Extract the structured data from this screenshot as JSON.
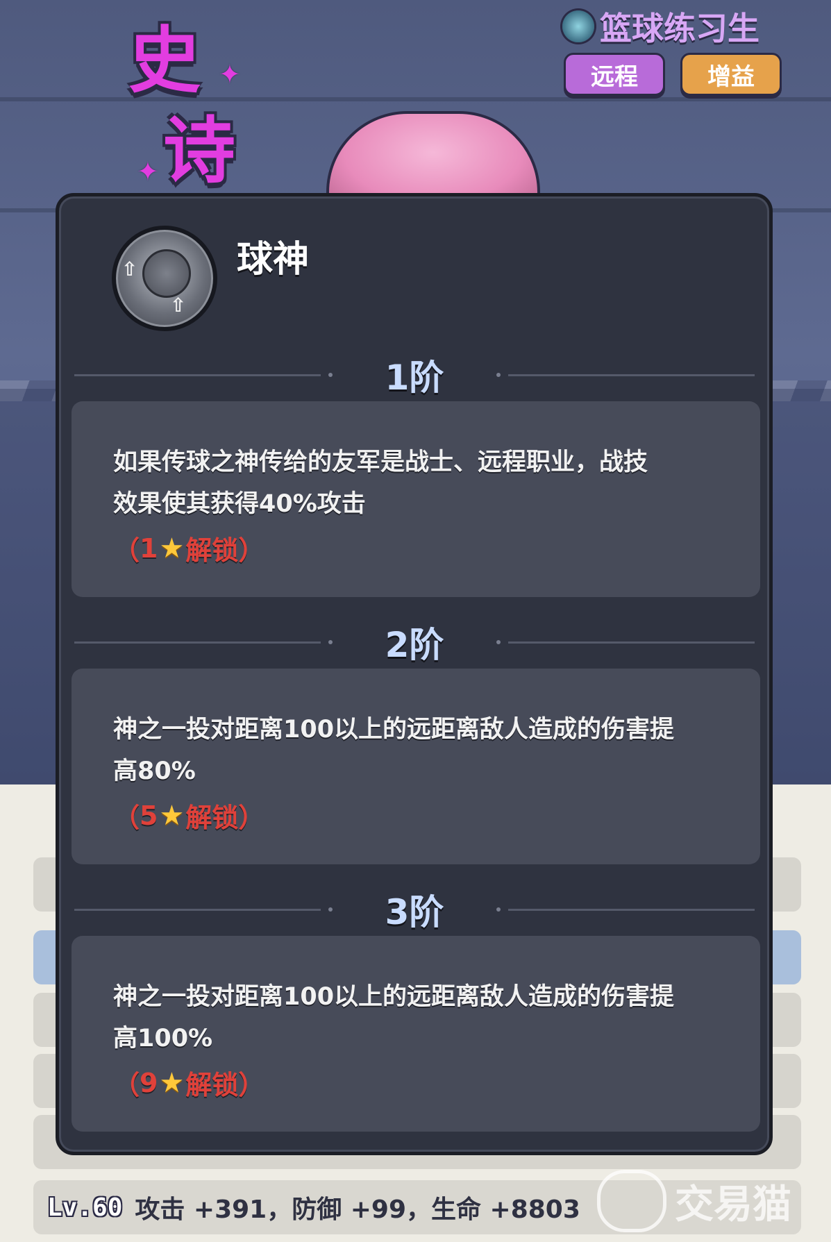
{
  "header": {
    "hero_name": "篮球练习生",
    "class_icon": "class-emblem-icon",
    "tags": [
      "远程",
      "增益"
    ],
    "rarity": [
      "史",
      "诗"
    ]
  },
  "skill": {
    "icon": "basketball-skill-icon",
    "name": "球神"
  },
  "tiers": [
    {
      "label": "1阶",
      "desc_line1": "如果传球之神传给的友军是战士、远程职业，战技",
      "desc_line2": "效果使其获得40%攻击",
      "unlock_open": "（",
      "unlock_stars": "1",
      "unlock_text": "解锁）"
    },
    {
      "label": "2阶",
      "desc_line1": "神之一投对距离100以上的远距离敌人造成的伤害提",
      "desc_line2": "高80%",
      "unlock_open": "（",
      "unlock_stars": "5",
      "unlock_text": "解锁）"
    },
    {
      "label": "3阶",
      "desc_line1": "神之一投对距离100以上的远距离敌人造成的伤害提",
      "desc_line2": "高100%",
      "unlock_open": "（",
      "unlock_stars": "9",
      "unlock_text": "解锁）"
    }
  ],
  "bottom": {
    "level": "Lv.60",
    "stats": "攻击 +391，防御 +99，生命 +8803"
  },
  "watermark": "交易猫",
  "colors": {
    "rarity": "#e23de0",
    "modal_bg": "#2f3340",
    "card_bg": "#474b59",
    "tier_label": "#c9dcff",
    "unlock_red": "#e0413a",
    "star": "#ffc83a"
  }
}
